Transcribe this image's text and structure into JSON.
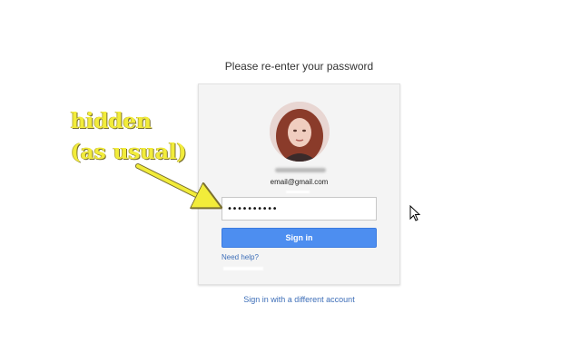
{
  "dialog": {
    "heading": "Please re-enter your password",
    "email": "email@gmail.com",
    "password_value": "••••••••••",
    "signin_label": "Sign in",
    "help_label": "Need help?"
  },
  "footer": {
    "different_account_label": "Sign in with a different account"
  },
  "annotation": {
    "line1": "hidden",
    "line2": "(as usual)",
    "color": "#f2ec3a"
  },
  "colors": {
    "accent": "#4d8ef0",
    "link": "#3d6eb8",
    "card_bg": "#f4f4f4"
  },
  "icons": {
    "avatar": "profile-photo",
    "cursor": "mouse-pointer-icon",
    "arrow": "annotation-arrow"
  }
}
